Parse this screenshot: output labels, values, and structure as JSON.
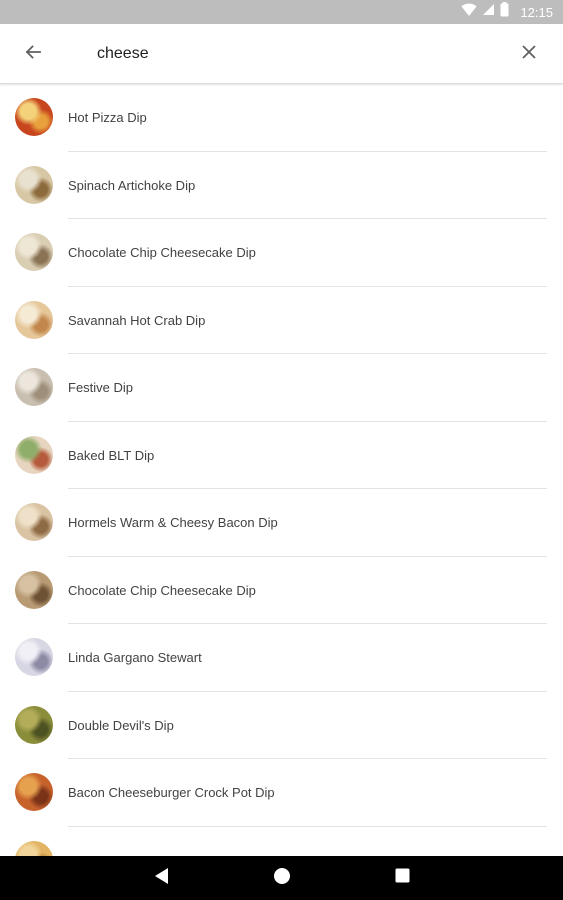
{
  "status_bar": {
    "time": "12:15",
    "icons": [
      "wifi-icon",
      "cell-signal-icon",
      "battery-icon"
    ]
  },
  "search": {
    "value": "cheese",
    "back_icon": "arrow-back-icon",
    "clear_icon": "close-icon"
  },
  "results": [
    {
      "label": "Hot Pizza Dip",
      "colors": [
        "#c8461e",
        "#e8a03c",
        "#f4d27a"
      ]
    },
    {
      "label": "Spinach Artichoke Dip",
      "colors": [
        "#d7c7a4",
        "#8c6a3c",
        "#e9e1cf"
      ]
    },
    {
      "label": "Chocolate Chip Cheesecake Dip",
      "colors": [
        "#d9cdb2",
        "#8a7355",
        "#efe7d6"
      ]
    },
    {
      "label": "Savannah Hot Crab Dip",
      "colors": [
        "#e6c79a",
        "#c2874c",
        "#f5ead4"
      ]
    },
    {
      "label": "Festive Dip",
      "colors": [
        "#c9bfb0",
        "#9e8f7a",
        "#ece6dc"
      ]
    },
    {
      "label": "Baked BLT Dip",
      "colors": [
        "#e8d5c0",
        "#b55a3a",
        "#8fae6a"
      ]
    },
    {
      "label": "Hormels Warm & Cheesy Bacon Dip",
      "colors": [
        "#d9c3a3",
        "#8f6b45",
        "#efe1c9"
      ]
    },
    {
      "label": "Chocolate Chip Cheesecake Dip",
      "colors": [
        "#b89a74",
        "#6e5234",
        "#d6c2a2"
      ]
    },
    {
      "label": "Linda Gargano Stewart",
      "colors": [
        "#d7d6e3",
        "#8d8aa6",
        "#f1f0f6"
      ]
    },
    {
      "label": "Double Devil's Dip",
      "colors": [
        "#8a8d3a",
        "#4d5222",
        "#b3ad5a"
      ]
    },
    {
      "label": "Bacon Cheeseburger Crock Pot Dip",
      "colors": [
        "#c7622c",
        "#7a3218",
        "#e6a14e"
      ]
    },
    {
      "label": "",
      "colors": [
        "#e2b463",
        "#b57b2d",
        "#f1d49a"
      ]
    }
  ],
  "nav_bar": {
    "buttons": [
      "back-triangle-icon",
      "home-circle-icon",
      "recents-square-icon"
    ]
  }
}
